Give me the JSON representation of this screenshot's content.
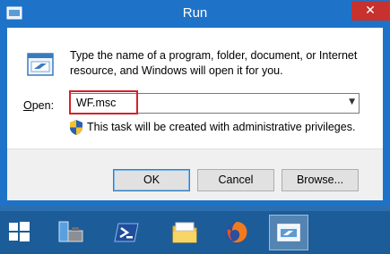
{
  "window": {
    "title": "Run",
    "close_glyph": "✕"
  },
  "dialog": {
    "description": "Type the name of a program, folder, document, or Internet resource, and Windows will open it for you.",
    "open_label_prefix": "",
    "open_label_accesskey": "O",
    "open_label_rest": "pen:",
    "open_value": "WF.msc",
    "dropdown_glyph": "▼",
    "admin_note": "This task will be created with administrative privileges."
  },
  "buttons": {
    "ok": "OK",
    "cancel": "Cancel",
    "browse": "Browse..."
  },
  "taskbar": {
    "items": [
      "start-icon",
      "server-manager-icon",
      "powershell-icon",
      "file-explorer-icon",
      "firefox-icon",
      "run-icon"
    ]
  },
  "colors": {
    "title_bar": "#1e73c8",
    "close_button": "#c7312e",
    "highlight_border": "#d4222c",
    "taskbar": "#1b5c99"
  }
}
